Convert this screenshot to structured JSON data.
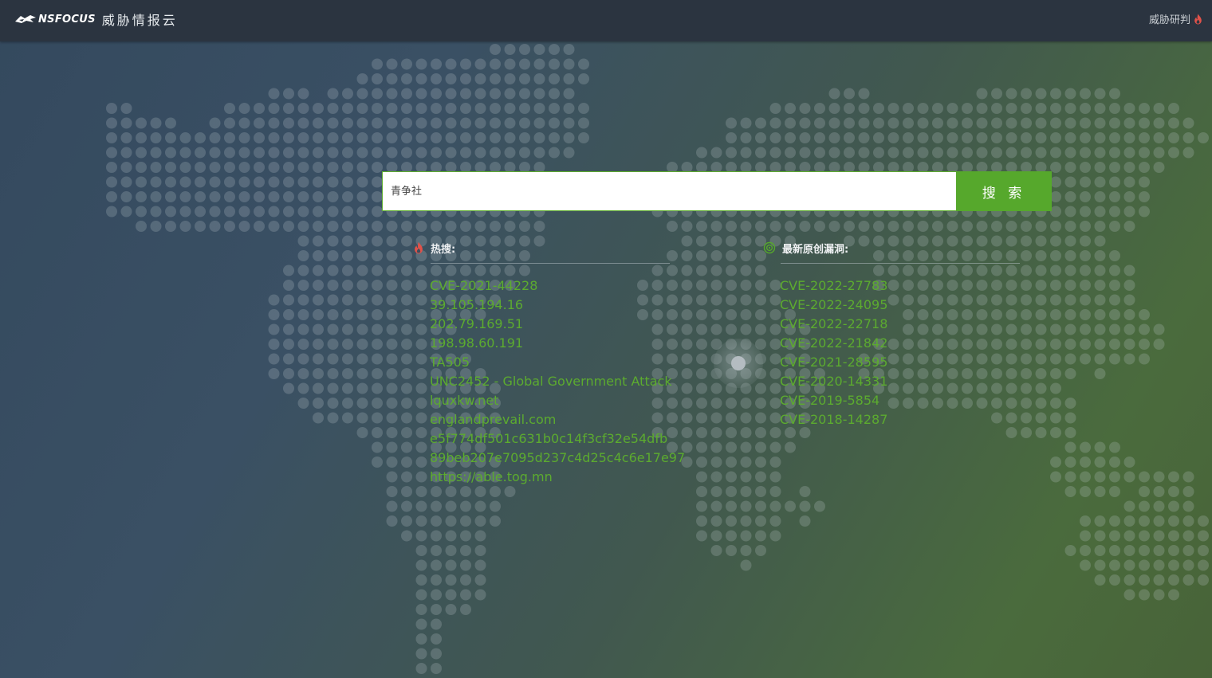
{
  "header": {
    "brand": "NSFOCUS",
    "product": "威胁情报云",
    "right_link": "威胁研判"
  },
  "search": {
    "placeholder": "青争社",
    "button_label": "搜 索"
  },
  "hot": {
    "title": "热搜:",
    "items": [
      "CVE-2021-44228",
      "39.105.194.16",
      "202.79.169.51",
      "198.98.60.191",
      "TA505",
      "UNC2452 - Global Government Attack",
      "lquxkw.net",
      "englandprevail.com",
      "e5f774df501c631b0c14f3cf32e54dfb",
      "89beb207e7095d237c4d25c4c6e17e97",
      "https://able.tog.mn"
    ]
  },
  "vulns": {
    "title": "最新原创漏洞:",
    "items": [
      "CVE-2022-27783",
      "CVE-2022-24095",
      "CVE-2022-22718",
      "CVE-2022-21842",
      "CVE-2021-28595",
      "CVE-2020-14331",
      "CVE-2019-5854",
      "CVE-2018-14287"
    ]
  },
  "colors": {
    "accent_green": "#56a82c",
    "link_green": "#5cab2f",
    "topbar": "#2b3440",
    "fire_red": "#e0524a"
  },
  "icons": {
    "logo": "nsfocus-logo-icon",
    "hot": "flame-icon",
    "vulns": "target-icon",
    "right_link": "flame-icon"
  }
}
